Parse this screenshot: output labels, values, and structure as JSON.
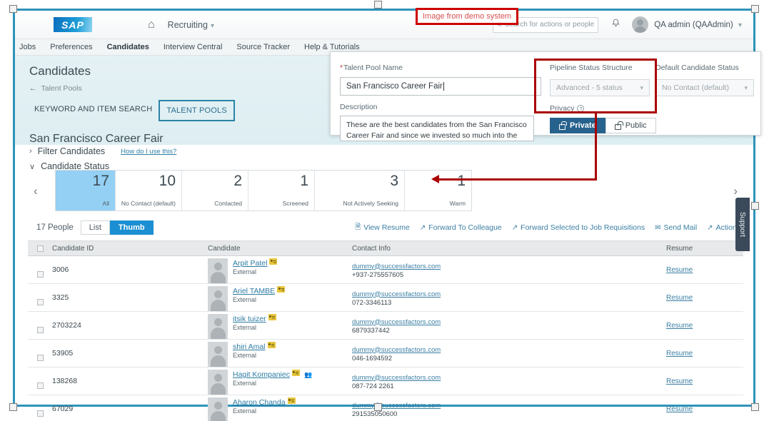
{
  "shell": {
    "logo_text": "SAP",
    "home_icon": "home-icon",
    "app_name": "Recruiting",
    "app_caret": "⌵",
    "search_placeholder": "Search for actions or people",
    "search_icon": "search-icon",
    "bell_icon": "bell-icon",
    "user_name": "QA admin (QAAdmin)",
    "user_caret": "⌵"
  },
  "annotation": {
    "demo_label": "Image from demo system"
  },
  "module_nav": [
    {
      "label": "Jobs",
      "active": false
    },
    {
      "label": "Preferences",
      "active": false
    },
    {
      "label": "Candidates",
      "active": true
    },
    {
      "label": "Interview Central",
      "active": false
    },
    {
      "label": "Source Tracker",
      "active": false
    },
    {
      "label": "Help & Tutorials",
      "active": false
    }
  ],
  "page": {
    "title": "Candidates",
    "back_arrow": "←",
    "breadcrumb": "Talent Pools",
    "tabs": [
      {
        "label": "KEYWORD AND ITEM SEARCH",
        "selected": false
      },
      {
        "label": "TALENT POOLS",
        "selected": true
      }
    ],
    "pool_name": "San Francisco Career Fair",
    "filter_candidates": "Filter Candidates",
    "filter_chevron": "›",
    "how_do_i_use_this": "How do I use this?",
    "candidate_status": "Candidate Status",
    "status_chevron": "∨"
  },
  "status_bar": {
    "prev_icon": "‹",
    "next_icon": "›",
    "cells": [
      {
        "count": "17",
        "label": "All",
        "selected": true
      },
      {
        "count": "10",
        "label": "No Contact (default)",
        "selected": false
      },
      {
        "count": "2",
        "label": "Contacted",
        "selected": false
      },
      {
        "count": "1",
        "label": "Screened",
        "selected": false
      },
      {
        "count": "3",
        "label": "Not Actively Seeking",
        "selected": false
      },
      {
        "count": "1",
        "label": "Warm",
        "selected": false
      }
    ]
  },
  "toolbar": {
    "people_count": "17 People",
    "view_list": "List",
    "view_thumb": "Thumb",
    "actions": [
      {
        "label": "View Resume",
        "icon": "document-icon"
      },
      {
        "label": "Forward To Colleague",
        "icon": "forward-arrow-icon"
      },
      {
        "label": "Forward Selected to Job Requisitions",
        "icon": "forward-arrow-icon"
      },
      {
        "label": "Send Mail",
        "icon": "envelope-icon"
      },
      {
        "label": "Actions",
        "icon": "external-link-icon"
      }
    ]
  },
  "table": {
    "columns": [
      "Candidate ID",
      "Candidate",
      "Contact Info",
      "Resume"
    ],
    "resume_link_label": "Resume",
    "rows": [
      {
        "id": "3006",
        "name": "Arpit Patel",
        "type": "External",
        "email": "dummy@successfactors.com",
        "phone": "+937-275557605",
        "group": false
      },
      {
        "id": "3325",
        "name": "Ariel TAMBE",
        "type": "External",
        "email": "dummy@successfactors.com",
        "phone": "072-3346113",
        "group": false
      },
      {
        "id": "2703224",
        "name": "itsik tuizer",
        "type": "External",
        "email": "dummy@successfactors.com",
        "phone": "6879337442",
        "group": false
      },
      {
        "id": "53905",
        "name": "shiri Amal",
        "type": "External",
        "email": "dummy@successfactors.com",
        "phone": "046-1694592",
        "group": false
      },
      {
        "id": "138268",
        "name": "Hagit Kompaniec",
        "type": "External",
        "email": "dummy@successfactors.com",
        "phone": "087-724 2261",
        "group": true
      },
      {
        "id": "67029",
        "name": "Aharon Chanda",
        "type": "External",
        "email": "dummy@successfactors.com",
        "phone": "291535050600",
        "group": false
      }
    ]
  },
  "support_tab": {
    "label": "Support"
  },
  "dialog": {
    "talent_pool_name_label": "Talent Pool Name",
    "talent_pool_name_value": "San Francisco Career Fair",
    "description_label": "Description",
    "description_value": "These are the best candidates from the San Francisco Career Fair and since we invested so much into the Fair, this",
    "pipeline_label": "Pipeline Status Structure",
    "pipeline_value": "Advanced - 5 status",
    "default_status_label": "Default Candidate Status",
    "default_status_value": "No Contact (default)",
    "privacy_label": "Privacy",
    "privacy_help_icon": "question-icon",
    "privacy_private": "Private",
    "privacy_public": "Public",
    "dropdown_caret": "⌵"
  },
  "colors": {
    "brand_blue": "#1b8fd1",
    "annotation_red": "#aa0000",
    "selected_cell": "#93d0f4",
    "privacy_selected": "#27628d",
    "frame_border": "#2e93b8",
    "link": "#3b7fa4"
  }
}
